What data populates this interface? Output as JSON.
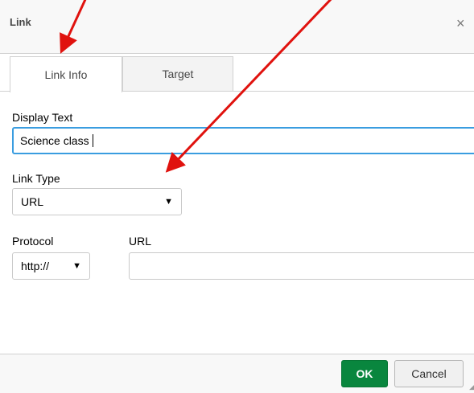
{
  "dialog": {
    "title": "Link",
    "close_glyph": "×"
  },
  "tabs": [
    {
      "label": "Link Info",
      "active": true
    },
    {
      "label": "Target",
      "active": false
    }
  ],
  "form": {
    "display_text_label": "Display Text",
    "display_text_value": "Science class",
    "link_type_label": "Link Type",
    "link_type_value": "URL",
    "protocol_label": "Protocol",
    "protocol_value": "http://",
    "url_label": "URL",
    "url_value": "",
    "dropdown_glyph": "▼"
  },
  "footer": {
    "ok_label": "OK",
    "cancel_label": "Cancel"
  },
  "annotations": {
    "arrow_color": "#e0120e"
  },
  "colors": {
    "ok_button": "#09863e",
    "focus_border": "#3a9de0"
  }
}
